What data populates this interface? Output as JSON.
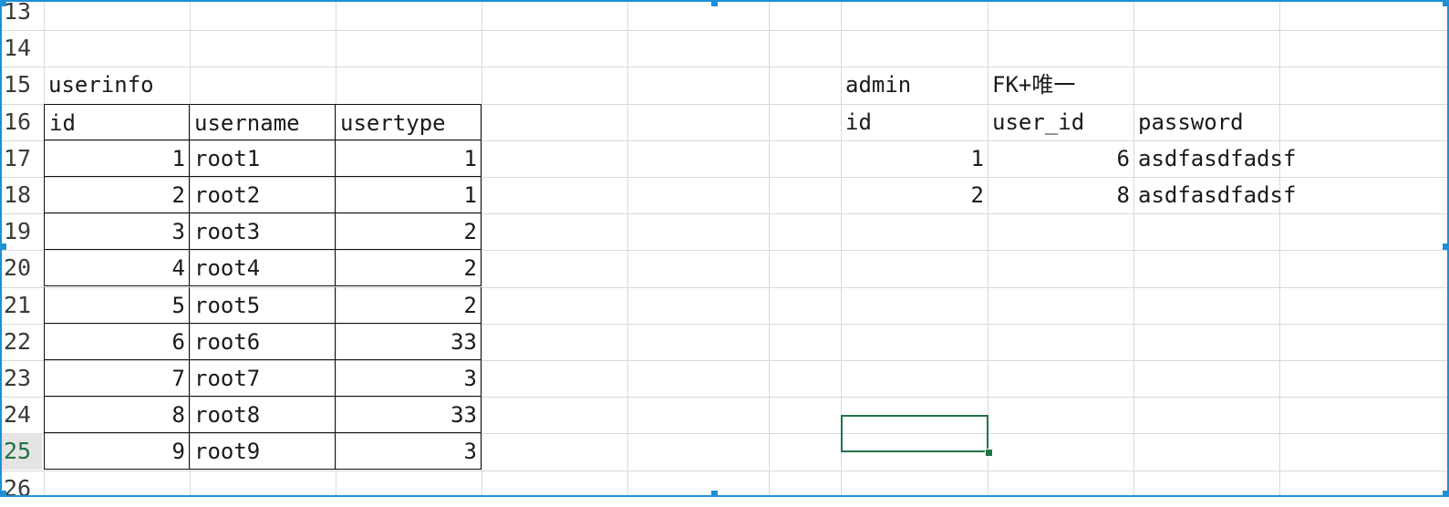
{
  "sheet": {
    "row_numbers": [
      "13",
      "14",
      "15",
      "16",
      "17",
      "18",
      "19",
      "20",
      "21",
      "22",
      "23",
      "24",
      "25",
      "26"
    ],
    "active_row": "25"
  },
  "userinfo": {
    "title": "userinfo",
    "headers": [
      "id",
      "username",
      "usertype"
    ],
    "rows": [
      [
        "1",
        "root1",
        "1"
      ],
      [
        "2",
        "root2",
        "1"
      ],
      [
        "3",
        "root3",
        "2"
      ],
      [
        "4",
        "root4",
        "2"
      ],
      [
        "5",
        "root5",
        "2"
      ],
      [
        "6",
        "root6",
        "33"
      ],
      [
        "7",
        "root7",
        "3"
      ],
      [
        "8",
        "root8",
        "33"
      ],
      [
        "9",
        "root9",
        "3"
      ]
    ]
  },
  "admin": {
    "title": "admin",
    "note": "FK+唯一",
    "headers": [
      "id",
      "user_id",
      "password"
    ],
    "rows": [
      [
        "1",
        "6",
        "asdfasdfadsf"
      ],
      [
        "2",
        "8",
        "asdfasdfadsf"
      ]
    ]
  },
  "colors": {
    "selection": "#217346",
    "gridline": "#d9d9d9",
    "frame": "#1e90d6"
  }
}
